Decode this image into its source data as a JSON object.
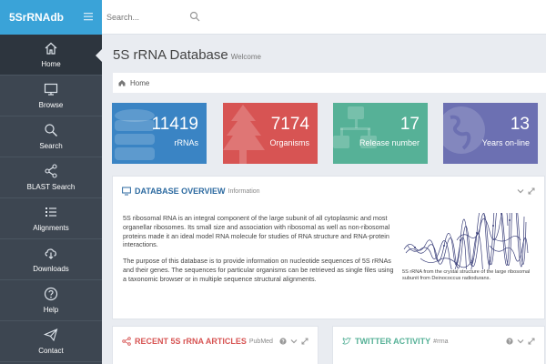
{
  "app": {
    "brand": "5SrRNAdb"
  },
  "search": {
    "placeholder": "Search..."
  },
  "sidebar": {
    "items": [
      {
        "label": "Home",
        "icon": "home-icon"
      },
      {
        "label": "Browse",
        "icon": "monitor-icon"
      },
      {
        "label": "Search",
        "icon": "search-icon"
      },
      {
        "label": "BLAST Search",
        "icon": "share-icon"
      },
      {
        "label": "Alignments",
        "icon": "list-icon"
      },
      {
        "label": "Downloads",
        "icon": "cloud-download-icon"
      },
      {
        "label": "Help",
        "icon": "help-icon"
      },
      {
        "label": "Contact",
        "icon": "paper-plane-icon"
      }
    ]
  },
  "main": {
    "title": "5S rRNA Database",
    "subtitle": "Welcome",
    "breadcrumb": "Home"
  },
  "stats": [
    {
      "value": "11419",
      "label": "rRNAs",
      "color": "#3a84c4"
    },
    {
      "value": "7174",
      "label": "Organisms",
      "color": "#d75453"
    },
    {
      "value": "17",
      "label": "Release number",
      "color": "#56b197"
    },
    {
      "value": "13",
      "label": "Years on-line",
      "color": "#6c70b2"
    }
  ],
  "overview": {
    "title": "DATABASE OVERVIEW",
    "subtitle": "Information",
    "para1": "5S ribosomal RNA is an integral component of the large subunit of all cytoplasmic and most organellar ribosomes. Its small size and association with ribosomal as well as non-ribosomal proteins made it an ideal model RNA molecule for studies of RNA structure and RNA-protein interactions.",
    "para2": "The purpose of this database is to provide information on nucleotide sequences of 5S rRNAs and their genes. The sequences for particular organisms can be retrieved as single files using a taxonomic browser or in multiple sequence structural alignments.",
    "caption": "5S rRNA from the crystal structure of the large ribosomal subunit from Deinococcus radiodurans."
  },
  "articles": {
    "title": "RECENT 5S rRNA ARTICLES",
    "subtitle": "PubMed",
    "color": "#d75453"
  },
  "twitter": {
    "title": "TWITTER ACTIVITY",
    "subtitle": "#rrna",
    "color": "#56b197"
  },
  "colors": {
    "brand": "#3aa3d8",
    "sidebar": "#3d4651",
    "overview_title": "#2c6aa0"
  }
}
